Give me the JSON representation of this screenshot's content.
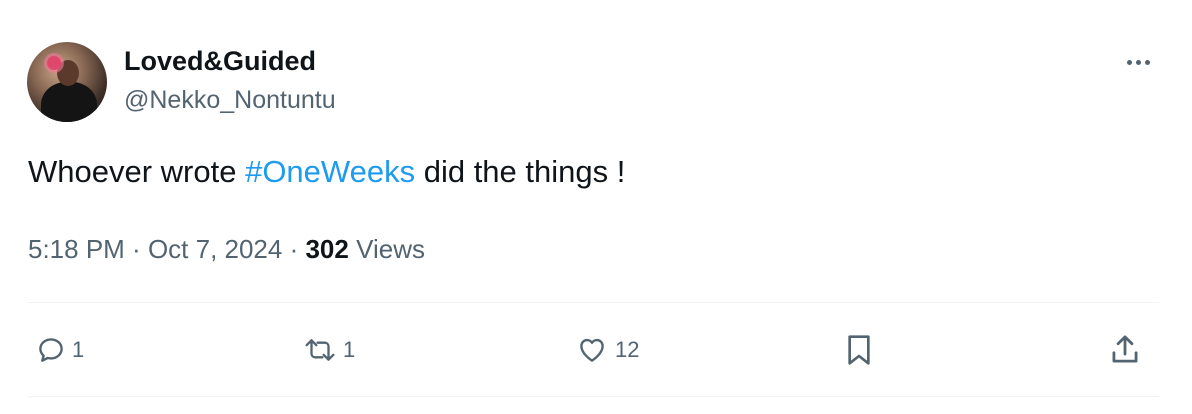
{
  "author": {
    "display_name": "Loved&Guided",
    "handle": "@Nekko_Nontuntu"
  },
  "tweet": {
    "text_before": "Whoever wrote ",
    "hashtag": "#OneWeeks",
    "text_after": " did the things !"
  },
  "meta": {
    "time": "5:18 PM",
    "separator": " · ",
    "date": "Oct 7, 2024",
    "views_count": "302",
    "views_label": " Views"
  },
  "actions": {
    "replies": "1",
    "retweets": "1",
    "likes": "12"
  },
  "colors": {
    "link": "#1d9bf0",
    "secondary_text": "#536471",
    "primary_text": "#0f1419",
    "divider": "#eff3f4"
  },
  "icons": [
    "more-icon",
    "reply-icon",
    "retweet-icon",
    "like-icon",
    "bookmark-icon",
    "share-icon"
  ]
}
